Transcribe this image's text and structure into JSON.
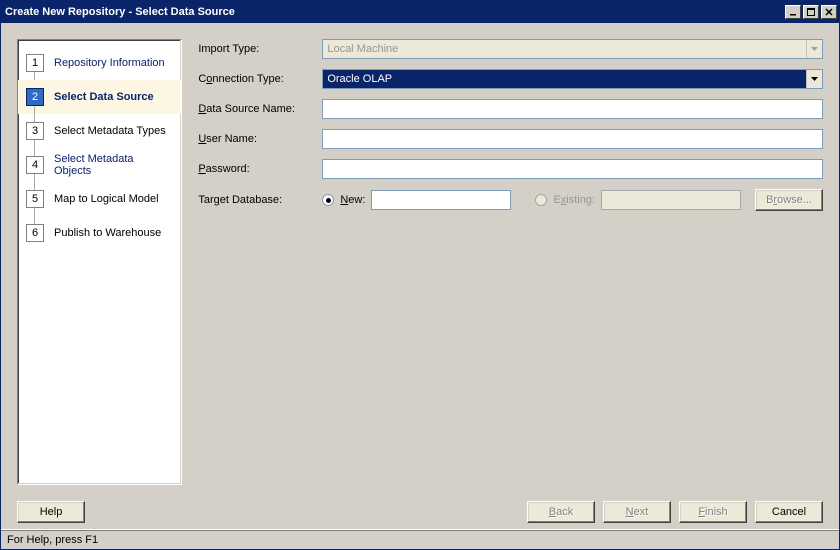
{
  "window": {
    "title": "Create New Repository - Select Data Source"
  },
  "sidebar": {
    "steps": [
      {
        "num": "1",
        "label": "Repository Information"
      },
      {
        "num": "2",
        "label": "Select Data Source"
      },
      {
        "num": "3",
        "label": "Select Metadata Types"
      },
      {
        "num": "4",
        "label": "Select Metadata Objects"
      },
      {
        "num": "5",
        "label": "Map to Logical Model"
      },
      {
        "num": "6",
        "label": "Publish to Warehouse"
      }
    ],
    "active_index": 1
  },
  "form": {
    "import_type": {
      "label": "Import Type:",
      "value": "Local Machine"
    },
    "connection_type": {
      "label_pre": "C",
      "label_accel": "o",
      "label_post": "nnection Type:",
      "value": "Oracle OLAP"
    },
    "data_source_name": {
      "label_pre": "",
      "label_accel": "D",
      "label_post": "ata Source Name:",
      "value": ""
    },
    "user_name": {
      "label_pre": "",
      "label_accel": "U",
      "label_post": "ser Name:",
      "value": ""
    },
    "password": {
      "label_pre": "",
      "label_accel": "P",
      "label_post": "assword:",
      "value": ""
    },
    "target_db": {
      "label_pre": "Tar",
      "label_accel": "g",
      "label_post": "et Database:"
    },
    "new_radio": {
      "label_accel": "N",
      "label_post": "ew:"
    },
    "existing_radio": {
      "label_pre": "E",
      "label_accel": "x",
      "label_post": "isting:"
    },
    "browse": {
      "label_pre": "B",
      "label_accel": "r",
      "label_post": "owse..."
    },
    "new_value": "",
    "existing_value": ""
  },
  "buttons": {
    "help": "Help",
    "back": {
      "accel": "B",
      "post": "ack"
    },
    "next": {
      "accel": "N",
      "post": "ext"
    },
    "finish": {
      "accel": "F",
      "post": "inish"
    },
    "cancel": "Cancel"
  },
  "status": {
    "text": "For Help, press F1"
  }
}
